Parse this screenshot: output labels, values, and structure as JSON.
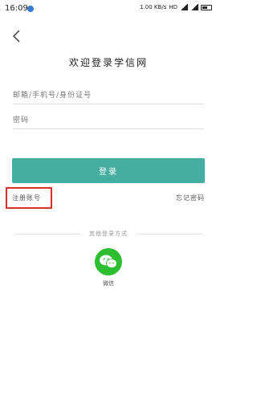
{
  "status_bar": {
    "time": "16:09",
    "network": "HD",
    "speed": "1.00 KB/s"
  },
  "header": {
    "welcome_text": "欢迎登录学信网"
  },
  "form": {
    "account_placeholder": "邮箱/手机号/身份证号",
    "password_placeholder": "密码",
    "login_label": "登录"
  },
  "links": {
    "register_label": "注册账号",
    "forgot_label": "忘记密码"
  },
  "other_login": {
    "divider_text": "其他登录方式",
    "wechat_label": "微信"
  },
  "colors": {
    "primary": "#46aea0",
    "highlight_box": "#d9302b",
    "wechat": "#2dbe31"
  }
}
